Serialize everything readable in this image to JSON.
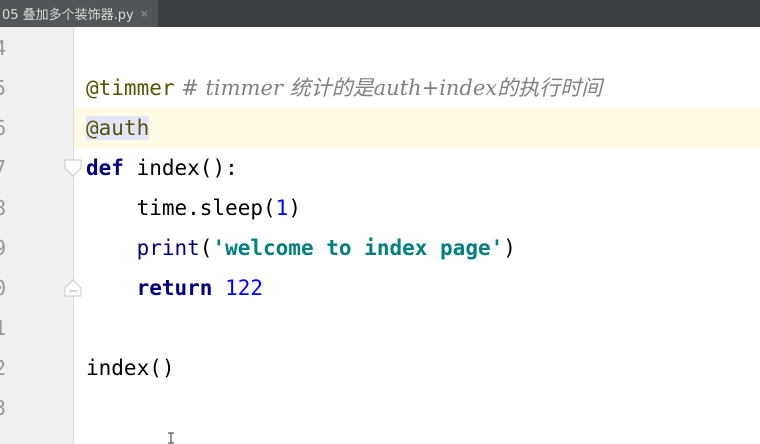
{
  "tab": {
    "title": "05 叠加多个装饰器.py",
    "close_symbol": "×"
  },
  "gutter": {
    "line_numbers": [
      "4",
      "5",
      "6",
      "7",
      "8",
      "9",
      "0",
      "1",
      "2",
      "3"
    ]
  },
  "code": {
    "line5": {
      "decorator": "@timmer",
      "comment": " # timmer 统计的是auth+index的执行时间"
    },
    "line6": {
      "decorator": "@auth"
    },
    "line7": {
      "keyword": "def",
      "rest": " index():"
    },
    "line8": {
      "pre": "    time.sleep(",
      "number": "1",
      "post": ")"
    },
    "line9": {
      "indent": "    ",
      "func": "print",
      "open": "(",
      "string": "'welcome to index page'",
      "close": ")"
    },
    "line10": {
      "indent": "    ",
      "keyword": "return",
      "space": " ",
      "number": "122"
    },
    "line12": {
      "text": "index()"
    }
  },
  "colors": {
    "tab_bar": "#3c3f41",
    "active_tab": "#515658",
    "current_line": "#fffae3",
    "gutter": "#f0f0f0"
  }
}
